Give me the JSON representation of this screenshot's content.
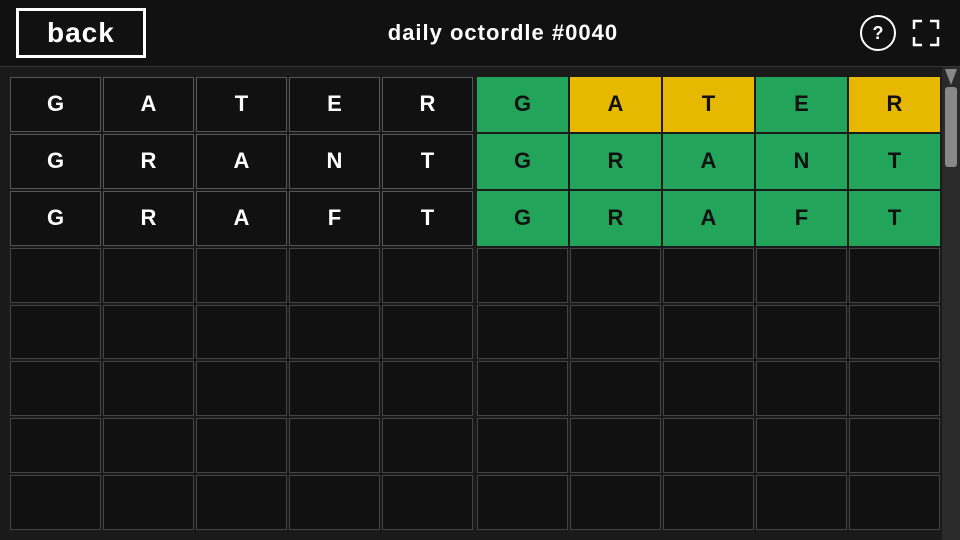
{
  "header": {
    "back_label": "back",
    "title": "daily octordle #0040",
    "help_label": "?",
    "colors": {
      "background": "#1a1a1a",
      "header_bg": "#111",
      "green": "#22a55a",
      "yellow": "#e6b800",
      "empty": "#111"
    }
  },
  "panels": [
    {
      "id": "left",
      "rows": [
        [
          {
            "letter": "G",
            "state": "white"
          },
          {
            "letter": "A",
            "state": "white"
          },
          {
            "letter": "T",
            "state": "white"
          },
          {
            "letter": "E",
            "state": "white"
          },
          {
            "letter": "R",
            "state": "white"
          }
        ],
        [
          {
            "letter": "G",
            "state": "white"
          },
          {
            "letter": "R",
            "state": "white"
          },
          {
            "letter": "A",
            "state": "white"
          },
          {
            "letter": "N",
            "state": "white"
          },
          {
            "letter": "T",
            "state": "white"
          }
        ],
        [
          {
            "letter": "G",
            "state": "white"
          },
          {
            "letter": "R",
            "state": "white"
          },
          {
            "letter": "A",
            "state": "white"
          },
          {
            "letter": "F",
            "state": "white"
          },
          {
            "letter": "T",
            "state": "white"
          }
        ],
        [
          {
            "letter": "",
            "state": "empty"
          },
          {
            "letter": "",
            "state": "empty"
          },
          {
            "letter": "",
            "state": "empty"
          },
          {
            "letter": "",
            "state": "empty"
          },
          {
            "letter": "",
            "state": "empty"
          }
        ],
        [
          {
            "letter": "",
            "state": "empty"
          },
          {
            "letter": "",
            "state": "empty"
          },
          {
            "letter": "",
            "state": "empty"
          },
          {
            "letter": "",
            "state": "empty"
          },
          {
            "letter": "",
            "state": "empty"
          }
        ],
        [
          {
            "letter": "",
            "state": "empty"
          },
          {
            "letter": "",
            "state": "empty"
          },
          {
            "letter": "",
            "state": "empty"
          },
          {
            "letter": "",
            "state": "empty"
          },
          {
            "letter": "",
            "state": "empty"
          }
        ],
        [
          {
            "letter": "",
            "state": "empty"
          },
          {
            "letter": "",
            "state": "empty"
          },
          {
            "letter": "",
            "state": "empty"
          },
          {
            "letter": "",
            "state": "empty"
          },
          {
            "letter": "",
            "state": "empty"
          }
        ],
        [
          {
            "letter": "",
            "state": "empty"
          },
          {
            "letter": "",
            "state": "empty"
          },
          {
            "letter": "",
            "state": "empty"
          },
          {
            "letter": "",
            "state": "empty"
          },
          {
            "letter": "",
            "state": "empty"
          }
        ]
      ]
    },
    {
      "id": "right",
      "rows": [
        [
          {
            "letter": "G",
            "state": "green"
          },
          {
            "letter": "A",
            "state": "yellow"
          },
          {
            "letter": "T",
            "state": "yellow"
          },
          {
            "letter": "E",
            "state": "green"
          },
          {
            "letter": "R",
            "state": "yellow"
          }
        ],
        [
          {
            "letter": "G",
            "state": "green"
          },
          {
            "letter": "R",
            "state": "green"
          },
          {
            "letter": "A",
            "state": "green"
          },
          {
            "letter": "N",
            "state": "green"
          },
          {
            "letter": "T",
            "state": "green"
          }
        ],
        [
          {
            "letter": "G",
            "state": "green"
          },
          {
            "letter": "R",
            "state": "green"
          },
          {
            "letter": "A",
            "state": "green"
          },
          {
            "letter": "F",
            "state": "green"
          },
          {
            "letter": "T",
            "state": "green"
          }
        ],
        [
          {
            "letter": "",
            "state": "empty"
          },
          {
            "letter": "",
            "state": "empty"
          },
          {
            "letter": "",
            "state": "empty"
          },
          {
            "letter": "",
            "state": "empty"
          },
          {
            "letter": "",
            "state": "empty"
          }
        ],
        [
          {
            "letter": "",
            "state": "empty"
          },
          {
            "letter": "",
            "state": "empty"
          },
          {
            "letter": "",
            "state": "empty"
          },
          {
            "letter": "",
            "state": "empty"
          },
          {
            "letter": "",
            "state": "empty"
          }
        ],
        [
          {
            "letter": "",
            "state": "empty"
          },
          {
            "letter": "",
            "state": "empty"
          },
          {
            "letter": "",
            "state": "empty"
          },
          {
            "letter": "",
            "state": "empty"
          },
          {
            "letter": "",
            "state": "empty"
          }
        ],
        [
          {
            "letter": "",
            "state": "empty"
          },
          {
            "letter": "",
            "state": "empty"
          },
          {
            "letter": "",
            "state": "empty"
          },
          {
            "letter": "",
            "state": "empty"
          },
          {
            "letter": "",
            "state": "empty"
          }
        ],
        [
          {
            "letter": "",
            "state": "empty"
          },
          {
            "letter": "",
            "state": "empty"
          },
          {
            "letter": "",
            "state": "empty"
          },
          {
            "letter": "",
            "state": "empty"
          },
          {
            "letter": "",
            "state": "empty"
          }
        ]
      ]
    }
  ]
}
